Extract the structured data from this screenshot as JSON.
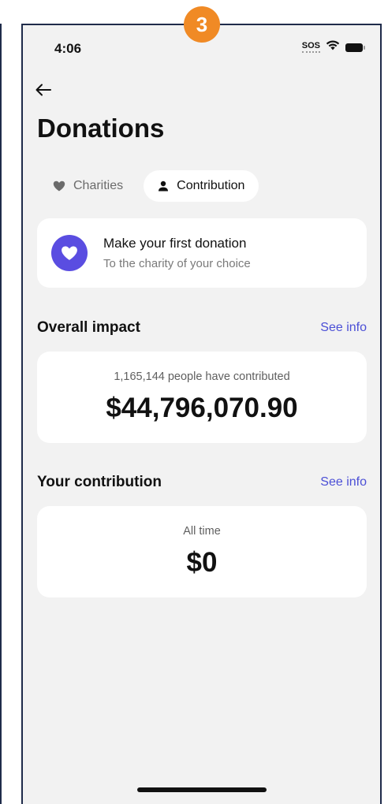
{
  "step_badge": "3",
  "status_bar": {
    "time": "4:06",
    "sos": "SOS",
    "icons": [
      "wifi-icon",
      "battery-icon"
    ]
  },
  "header": {
    "back_icon": "arrow-left-icon",
    "title": "Donations"
  },
  "tabs": [
    {
      "label": "Charities",
      "icon": "heart-icon",
      "active": false
    },
    {
      "label": "Contribution",
      "icon": "person-icon",
      "active": true
    }
  ],
  "first_donation": {
    "icon": "heart-icon",
    "title": "Make your first donation",
    "subtitle": "To the charity of your choice"
  },
  "overall_impact": {
    "heading": "Overall impact",
    "link": "See info",
    "caption": "1,165,144 people have contributed",
    "amount": "$44,796,070.90"
  },
  "your_contribution": {
    "heading": "Your contribution",
    "link": "See info",
    "caption": "All time",
    "amount": "$0"
  },
  "colors": {
    "accent": "#5a4de1",
    "link": "#4b4fd6",
    "badge": "#f08a25",
    "background": "#f2f2f2"
  }
}
